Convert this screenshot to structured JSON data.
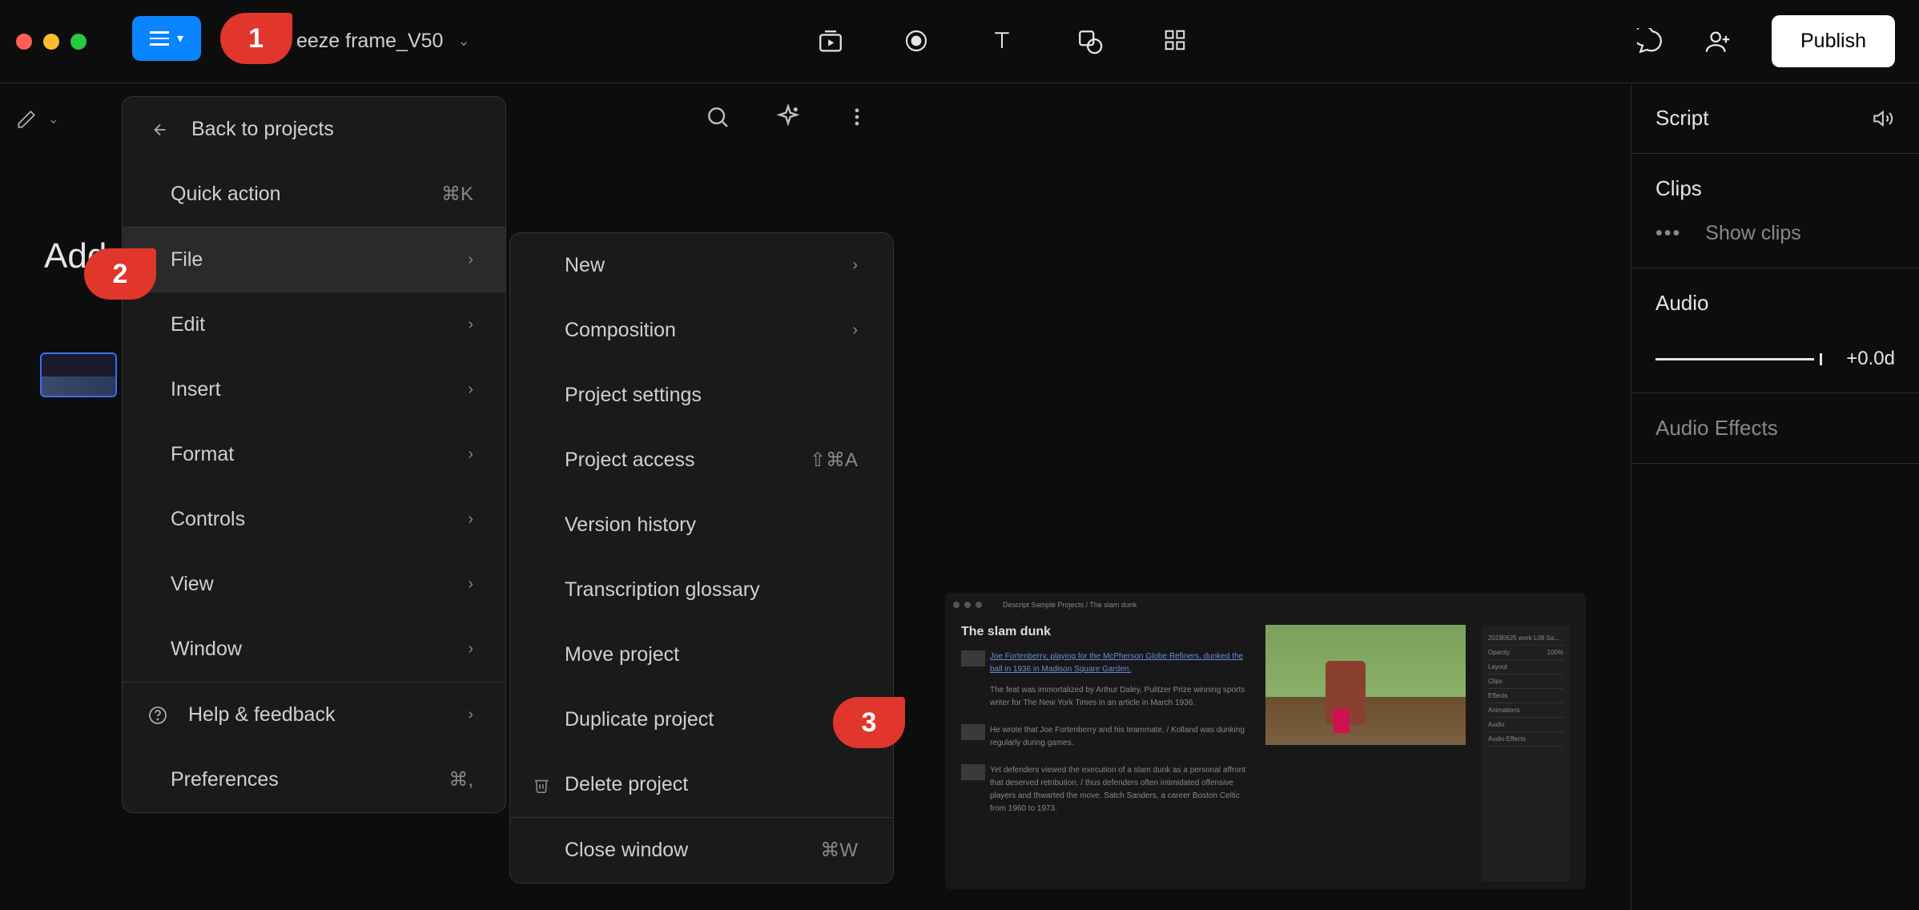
{
  "window": {
    "project_title": "eeze frame_V50"
  },
  "top_actions": {
    "publish": "Publish"
  },
  "left": {
    "add_label": "Add"
  },
  "menu_main": {
    "back": "Back to projects",
    "quick_action": "Quick action",
    "quick_action_shortcut": "⌘K",
    "file": "File",
    "edit": "Edit",
    "insert": "Insert",
    "format": "Format",
    "controls": "Controls",
    "view": "View",
    "window": "Window",
    "help": "Help & feedback",
    "preferences": "Preferences",
    "preferences_shortcut": "⌘,"
  },
  "menu_sub": {
    "new": "New",
    "composition": "Composition",
    "project_settings": "Project settings",
    "project_access": "Project access",
    "project_access_shortcut": "⇧⌘A",
    "version_history": "Version history",
    "transcription_glossary": "Transcription glossary",
    "move_project": "Move project",
    "duplicate_project": "Duplicate project",
    "delete_project": "Delete project",
    "close_window": "Close window",
    "close_window_shortcut": "⌘W"
  },
  "right_panel": {
    "script": "Script",
    "clips": "Clips",
    "show_clips": "Show clips",
    "audio": "Audio",
    "audio_value": "+0.0d",
    "audio_effects": "Audio Effects"
  },
  "preview": {
    "title": "The slam dunk",
    "breadcrumb": "Descript Sample Projects / The slam dunk",
    "line1": "Joe Fortenberry, playing for the McPherson Globe Refiners, dunked the ball in 1936 in Madison Square Garden.",
    "line1b": "The feat was immortalized by Arthur Daley, Pulitzer Prize winning sports writer for The New York Times in an article in March 1936.",
    "line2": "He wrote that Joe Fortenberry and his teammate, / Kolland was dunking regularly during games.",
    "line3": "Yet defenders viewed the execution of a slam dunk as a personal affront that deserved retribution. / thus defenders often intimidated offensive players and thwarted the move. Satch Sanders, a career Boston Celtic from 1960 to 1973.",
    "sidebar_title": "20190625 work L08 Sa...",
    "opacity_label": "Opacity",
    "opacity_val": "100%",
    "layout_label": "Layout",
    "clips_label": "Clips",
    "effects_label": "Effects",
    "animations_label": "Animations",
    "audio_label": "Audio",
    "audio_effects_label": "Audio Effects"
  },
  "markers": {
    "m1": "1",
    "m2": "2",
    "m3": "3"
  }
}
